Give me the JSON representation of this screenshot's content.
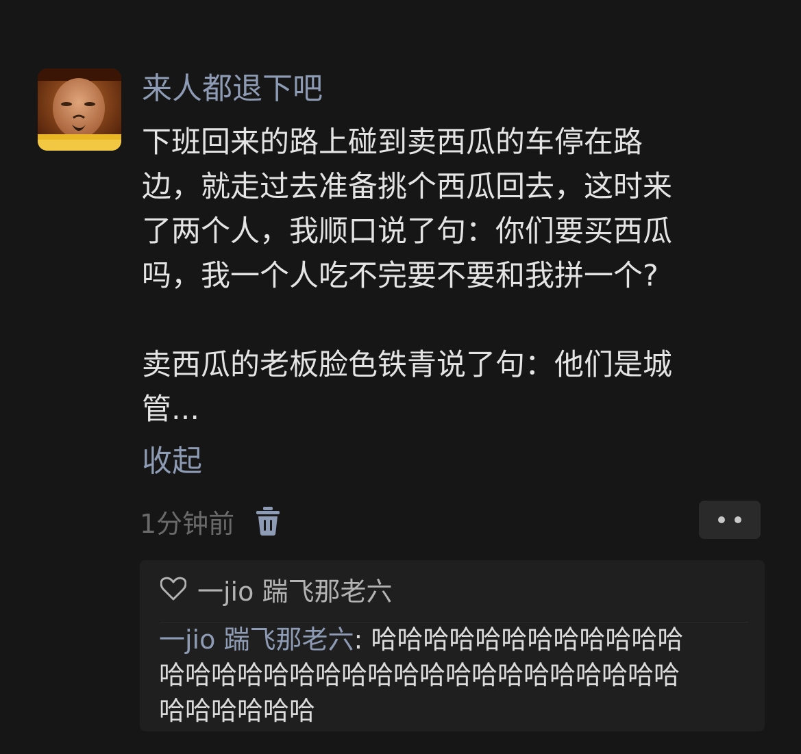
{
  "post": {
    "username": "来人都退下吧",
    "content_lines": [
      "下班回来的路上碰到卖西瓜的车停在路",
      "边，就走过去准备挑个西瓜回去，这时来",
      "了两个人，我顺口说了句：你们要买西瓜",
      "吗，我一个人吃不完要不要和我拼一个?",
      "",
      "卖西瓜的老板脸色铁青说了句：他们是城",
      "管..."
    ],
    "collapse_label": "收起",
    "timestamp": "1分钟前",
    "trash_icon": "trash-icon",
    "more_icon": "more-dots-icon"
  },
  "likes": {
    "icon": "heart-icon",
    "user": "一jio 踹飞那老六"
  },
  "reply": {
    "author": "一jio 踹飞那老六",
    "separator": ": ",
    "lines": [
      "哈哈哈哈哈哈哈哈哈哈哈哈",
      "哈哈哈哈哈哈哈哈哈哈哈哈哈哈哈哈哈哈哈哈",
      "哈哈哈哈哈哈"
    ]
  },
  "colors": {
    "background": "#161616",
    "accent_name": "#8e9bb4",
    "text": "#e4e4e4",
    "muted": "#6a6a6a",
    "reply_box": "#1f1f1f"
  }
}
